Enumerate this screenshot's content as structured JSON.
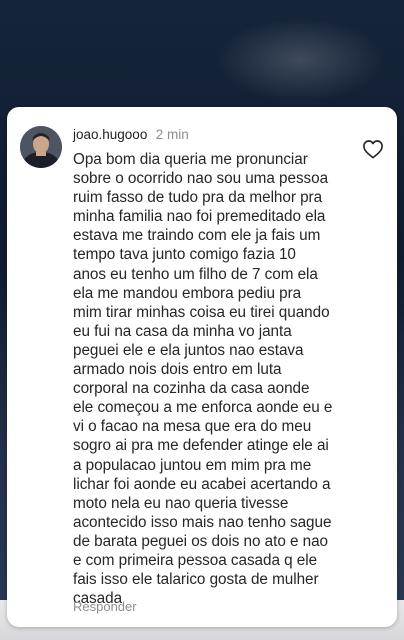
{
  "comment": {
    "username": "joao.hugooo",
    "time": "2 min",
    "text": "Opa bom dia queria me pronunciar\nsobre o ocorrido nao sou uma pessoa\nruim fasso de tudo pra da melhor pra\nminha familia nao foi premeditado ela\nestava me traindo com ele ja fais um\ntempo tava junto comigo fazia 10\nanos eu tenho um filho de 7 com ela\nela me mandou embora pediu pra\nmim tirar minhas coisa eu tirei quando\neu fui na casa da minha vo janta\npeguei ele e ela juntos nao estava\narmado nois dois entro em luta\ncorporal na cozinha da casa  aonde\nele começou a me enforca aonde eu e\nvi o facao na mesa que era do meu\nsogro ai pra me defender atinge ele ai\na populacao juntou em mim pra me\nlichar foi aonde eu acabei acertando a\nmoto nela eu nao queria tivesse\nacontecido isso mais nao tenho sague\nde barata peguei os dois no ato e nao\ne com primeira pessoa casada q ele\nfais isso ele talarico gosta de mulher\ncasada",
    "reply_label": "Responder",
    "icons": {
      "avatar": "user-avatar",
      "like": "heart-icon"
    }
  },
  "colors": {
    "text": "#262626",
    "meta": "#8e8e8e",
    "card": "#ffffff"
  }
}
